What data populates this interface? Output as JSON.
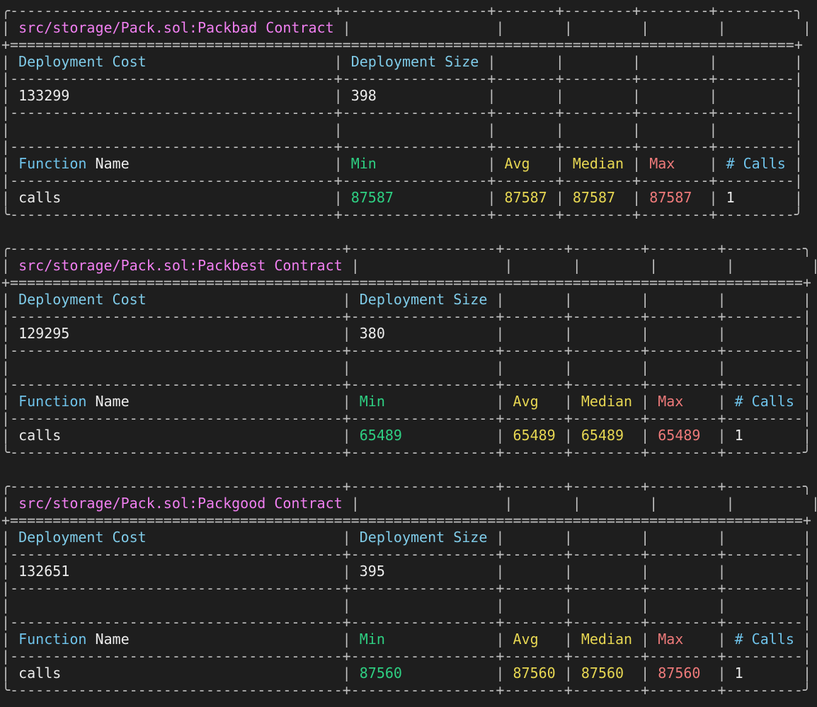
{
  "window": {
    "app": "terminal",
    "theme": {
      "background": "#1e1e1e",
      "border": "#bfbfbf",
      "text": "#ececec",
      "title": "#f07ff0",
      "header": "#7fcbe8",
      "min": "#2ecf82",
      "avg_median": "#e6d652",
      "max": "#ee7a7a"
    }
  },
  "labels": {
    "deployment_cost": "Deployment Cost",
    "deployment_size": "Deployment Size",
    "function": "Function",
    "name": "Name",
    "min": "Min",
    "avg": "Avg",
    "median": "Median",
    "max": "Max",
    "calls": "# Calls"
  },
  "reports": [
    {
      "contract": "src/storage/Pack.sol:Packbad Contract",
      "deployment_cost": "133299",
      "deployment_size": "398",
      "functions": [
        {
          "name": "calls",
          "min": "87587",
          "avg": "87587",
          "median": "87587",
          "max": "87587",
          "calls": "1"
        }
      ]
    },
    {
      "contract": "src/storage/Pack.sol:Packbest Contract",
      "deployment_cost": "129295",
      "deployment_size": "380",
      "functions": [
        {
          "name": "calls",
          "min": "65489",
          "avg": "65489",
          "median": "65489",
          "max": "65489",
          "calls": "1"
        }
      ]
    },
    {
      "contract": "src/storage/Pack.sol:Packgood Contract",
      "deployment_cost": "132651",
      "deployment_size": "395",
      "functions": [
        {
          "name": "calls",
          "min": "87560",
          "avg": "87560",
          "median": "87560",
          "max": "87560",
          "calls": "1"
        }
      ]
    }
  ]
}
